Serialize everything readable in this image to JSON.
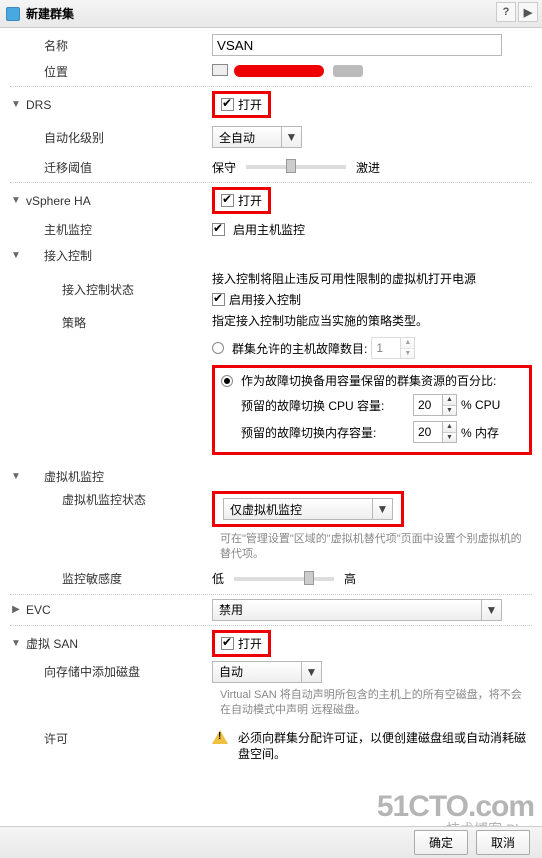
{
  "title": "新建群集",
  "fields": {
    "name_label": "名称",
    "name_value": "VSAN",
    "location_label": "位置",
    "drs_label": "DRS",
    "open_label": "打开",
    "automation_label": "自动化级别",
    "automation_value": "全自动",
    "migration_label": "迁移阈值",
    "migration_left": "保守",
    "migration_right": "激进",
    "ha_label": "vSphere HA",
    "host_monitor_label": "主机监控",
    "host_monitor_value": "启用主机监控",
    "admission_label": "接入控制",
    "admission_state_label": "接入控制状态",
    "admission_desc": "接入控制将阻止违反可用性限制的虚拟机打开电源",
    "admission_enable": "启用接入控制",
    "policy_label": "策略",
    "policy_desc": "指定接入控制功能应当实施的策略类型。",
    "policy_radio1": "群集允许的主机故障数目:",
    "policy_radio1_val": "1",
    "policy_radio2": "作为故障切换备用容量保留的群集资源的百分比:",
    "cpu_reserve_label": "预留的故障切换 CPU 容量:",
    "cpu_reserve_val": "20",
    "cpu_reserve_unit": "%   CPU",
    "mem_reserve_label": "预留的故障切换内存容量:",
    "mem_reserve_val": "20",
    "mem_reserve_unit": "%   内存",
    "vm_monitor_label": "虚拟机监控",
    "vm_monitor_state_label": "虚拟机监控状态",
    "vm_monitor_value": "仅虚拟机监控",
    "vm_monitor_note": "可在\"管理设置\"区域的\"虚拟机替代项\"页面中设置个别虚拟机的替代项。",
    "sensitivity_label": "监控敏感度",
    "sensitivity_low": "低",
    "sensitivity_high": "高",
    "evc_label": "EVC",
    "evc_value": "禁用",
    "vsan_label": "虚拟 SAN",
    "vsan_add_label": "向存储中添加磁盘",
    "vsan_add_value": "自动",
    "vsan_note": "Virtual SAN 将自动声明所包含的主机上的所有空磁盘，将不会在自动模式中声明 远程磁盘。",
    "license_label": "许可",
    "license_warn": "必须向群集分配许可证，以便创建磁盘组或自动消耗磁盘空间。"
  },
  "footer": {
    "ok": "确定",
    "cancel": "取消"
  },
  "watermark": {
    "line1": "51CTO.com",
    "line2": "技术博客    Blog"
  }
}
